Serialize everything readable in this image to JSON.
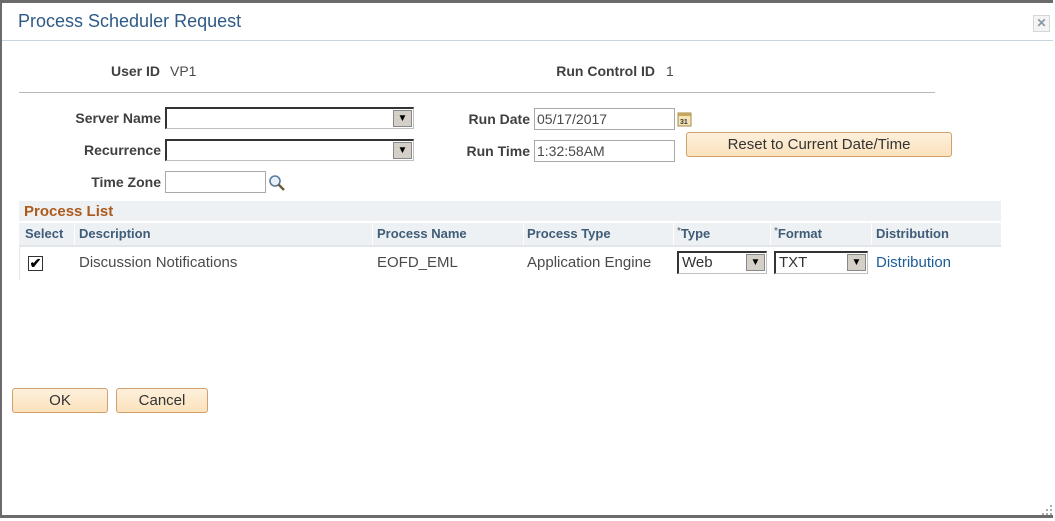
{
  "dialog": {
    "title": "Process Scheduler Request",
    "close_icon": "close-icon"
  },
  "header": {
    "user_id_label": "User ID",
    "user_id_value": "VP1",
    "run_control_label": "Run Control ID",
    "run_control_value": "1"
  },
  "form": {
    "server_name_label": "Server Name",
    "server_name_value": "",
    "recurrence_label": "Recurrence",
    "recurrence_value": "",
    "time_zone_label": "Time Zone",
    "time_zone_value": "",
    "run_date_label": "Run Date",
    "run_date_value": "05/17/2017",
    "run_time_label": "Run Time",
    "run_time_value": "1:32:58AM",
    "reset_button": "Reset to Current Date/Time",
    "dropdown_arrow": "▾"
  },
  "process_list": {
    "title": "Process List",
    "columns": [
      "Select",
      "Description",
      "Process Name",
      "Process Type",
      "Type",
      "Format",
      "Distribution"
    ],
    "required_marker": "*",
    "rows": [
      {
        "selected": true,
        "check_glyph": "✔",
        "description": "Discussion Notifications",
        "process_name": "EOFD_EML",
        "process_type": "Application Engine",
        "type": "Web",
        "format": "TXT",
        "distribution": "Distribution"
      }
    ]
  },
  "footer": {
    "ok_button": "OK",
    "cancel_button": "Cancel"
  },
  "colors": {
    "title": "#2e5a87",
    "section_title": "#ad5a1d",
    "column_header": "#3f5c79",
    "link": "#1c5c97",
    "button_bg": "#fbe2bc",
    "button_border": "#d3a06b"
  }
}
